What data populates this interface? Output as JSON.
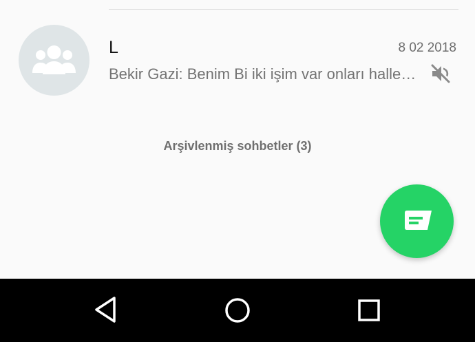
{
  "chat_list": {
    "items": [
      {
        "name": "L",
        "time": "8 02 2018",
        "preview": "Bekir Gazi: Benim Bi iki işim var onları hallediyim",
        "avatar_icon": "group-avatar-icon",
        "muted": true,
        "mute_icon": "muted-speaker-icon"
      }
    ],
    "archived_label": "Arşivlenmiş sohbetler (3)"
  },
  "fab": {
    "icon": "new-chat-icon",
    "color": "#25d366"
  },
  "nav": {
    "back_icon": "back-triangle-icon",
    "home_icon": "home-circle-icon",
    "recents_icon": "recents-square-icon"
  }
}
